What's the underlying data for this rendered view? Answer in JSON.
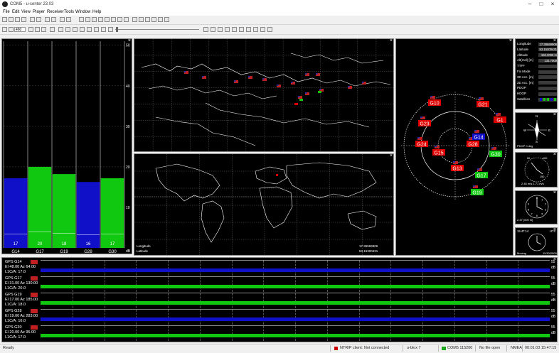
{
  "window": {
    "title": "COM5 - u-center 23.03",
    "minimize": "–",
    "maximize": "□",
    "close": "×"
  },
  "menu": [
    "File",
    "Edit",
    "View",
    "Player",
    "Receiver",
    "Tools",
    "Window",
    "Help"
  ],
  "toolbar": {
    "baud_value": "460"
  },
  "signal_panel": {
    "axis_ticks": [
      "50",
      "40",
      "30",
      "20",
      "10",
      "dB"
    ],
    "bars": [
      {
        "id": "G14",
        "value": 17,
        "level": 0.337,
        "color": "#1010c8"
      },
      {
        "id": "G17",
        "value": 20,
        "level": 0.392,
        "color": "#10c810"
      },
      {
        "id": "G19",
        "value": 18,
        "level": 0.357,
        "color": "#10c810"
      },
      {
        "id": "G28",
        "value": 16,
        "level": 0.319,
        "color": "#1010c8"
      },
      {
        "id": "G30",
        "value": 17,
        "level": 0.337,
        "color": "#10c810"
      }
    ]
  },
  "world_map": {
    "longitude_label": "Longitude",
    "latitude_label": "Latitude",
    "longitude_value": "17.36569906",
    "latitude_value": "53.15300431"
  },
  "sky_view": {
    "satellites": [
      {
        "id": "G10",
        "color": "#e00000"
      },
      {
        "id": "G21",
        "color": "#e00000"
      },
      {
        "id": "G23",
        "color": "#e00000"
      },
      {
        "id": "G1",
        "color": "#e00000"
      },
      {
        "id": "G24",
        "color": "#e00000"
      },
      {
        "id": "G15",
        "color": "#e00000"
      },
      {
        "id": "G28",
        "color": "#e00000"
      },
      {
        "id": "G14",
        "color": "#1010c8"
      },
      {
        "id": "G30",
        "color": "#10c810"
      },
      {
        "id": "G13",
        "color": "#e00000"
      },
      {
        "id": "G17",
        "color": "#10c810"
      },
      {
        "id": "G19",
        "color": "#10c810"
      }
    ]
  },
  "info_panel": {
    "rows": [
      {
        "label": "Longitude",
        "value": "17.36569906"
      },
      {
        "label": "Latitude",
        "value": "53.15300431"
      },
      {
        "label": "Altitude",
        "value": "162.3000 m"
      },
      {
        "label": "Alt(msl) [m]",
        "value": "131.7000"
      },
      {
        "label": "TTFF",
        "value": ""
      },
      {
        "label": "Fix Mode",
        "value": ""
      },
      {
        "label": "3D Acc. [m]",
        "value": ""
      },
      {
        "label": "2D Acc. [m]",
        "value": ""
      },
      {
        "label": "PDOP",
        "value": ""
      },
      {
        "label": "HDOP",
        "value": ""
      },
      {
        "label": "Satellites",
        "value": ""
      }
    ]
  },
  "compass": {
    "heading_text": "PDOP 0 deg",
    "n": "N",
    "s": "S",
    "e": "E",
    "w": "W"
  },
  "speed_gauge": {
    "text": "2.45 m/s  1.71 m/s",
    "ticks": [
      "50",
      "100",
      "150"
    ]
  },
  "altitude_gauge": {
    "text": "2.47 [000 m]",
    "ticks": [
      "0",
      "1",
      "2",
      "3",
      "5",
      "6",
      "7",
      "8",
      "9"
    ]
  },
  "clock": {
    "time": "15:47:14",
    "tz": "UTC",
    "date": "11/30/2009",
    "mode_label": "Moving"
  },
  "timeline": {
    "rows": [
      {
        "name": "GPS G14",
        "elaz": "El 48.00 Az 64.00",
        "l1": "L1C/A: 17.0",
        "color": "#1010c8",
        "fill": 0.33,
        "scale": [
          "55",
          "dB"
        ]
      },
      {
        "name": "GPS G17",
        "elaz": "El 31.00 Az 130.00",
        "l1": "L1C/A: 20.0",
        "color": "#10c810",
        "fill": 0.33,
        "scale": [
          "55",
          "dB"
        ]
      },
      {
        "name": "GPS G19",
        "elaz": "El 17.00 Az 185.00",
        "l1": "L1C/A: 18.0",
        "color": "#10c810",
        "fill": 0.33,
        "scale": [
          "55",
          "dB"
        ]
      },
      {
        "name": "GPS G28",
        "elaz": "El 19.00 Az 283.00",
        "l1": "L1C/A: 16.0",
        "color": "#1010c8",
        "fill": 0.33,
        "scale": [
          "55",
          "dB"
        ]
      },
      {
        "name": "GPS G30",
        "elaz": "El 20.00 Az 95.00",
        "l1": "L1C/A: 17.0",
        "color": "#10c810",
        "fill": 0.33,
        "scale": [
          "55",
          "dB"
        ]
      }
    ]
  },
  "statusbar": {
    "ready": "Ready",
    "ntrip": "NTRIP client: Not connected",
    "receiver": "u-blox 7",
    "port": "COM5 115200",
    "file": "No file open",
    "protocol": "NMEA",
    "time": "00:01:03 15:47:15"
  },
  "colors": {
    "accent_green": "#10c810",
    "accent_blue": "#1010c8",
    "accent_red": "#e00000"
  }
}
